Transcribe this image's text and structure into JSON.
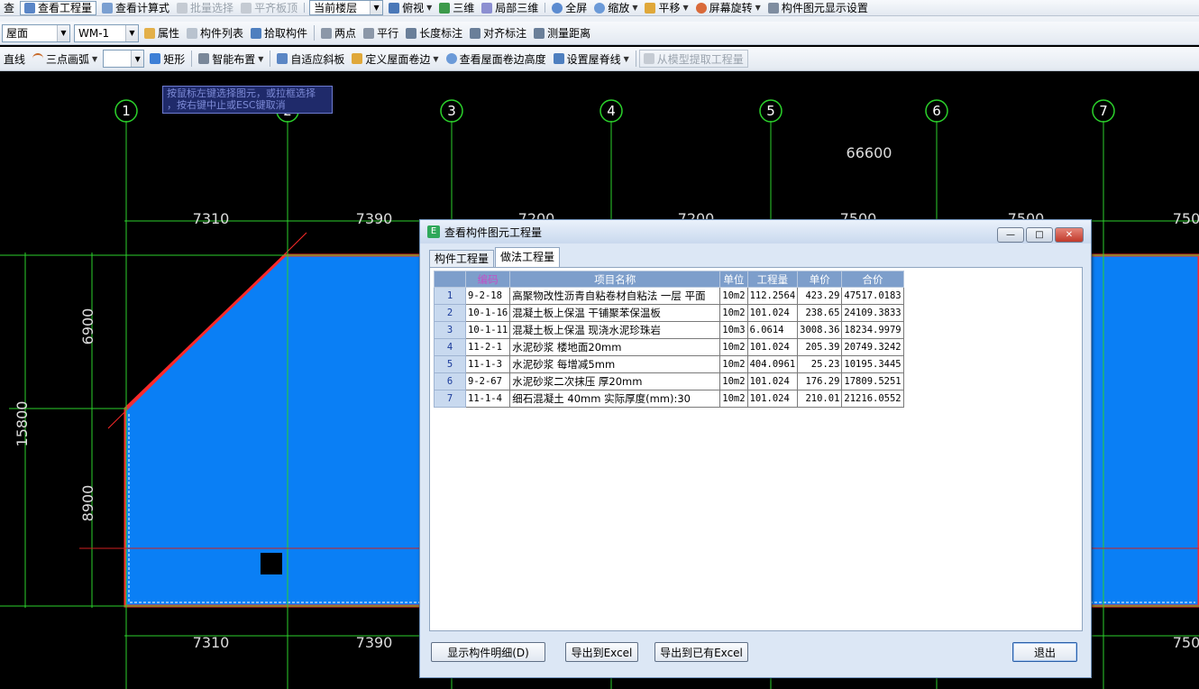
{
  "toolbar1": {
    "items": [
      {
        "label": "查",
        "state": "normal"
      },
      {
        "label": "查看工程量",
        "state": "active"
      },
      {
        "label": "查看计算式",
        "state": "normal"
      },
      {
        "label": "批量选择",
        "state": "disabled"
      },
      {
        "label": "平齐板顶",
        "state": "disabled"
      },
      {
        "label": "当前楼层",
        "state": "combo"
      },
      {
        "label": "俯视",
        "state": "normal"
      },
      {
        "label": "三维",
        "state": "normal"
      },
      {
        "label": "局部三维",
        "state": "normal"
      },
      {
        "label": "全屏",
        "state": "normal"
      },
      {
        "label": "缩放",
        "state": "normal"
      },
      {
        "label": "平移",
        "state": "normal"
      },
      {
        "label": "屏幕旋转",
        "state": "normal"
      },
      {
        "label": "构件图元显示设置",
        "state": "normal"
      }
    ]
  },
  "toolbar2": {
    "floor_combo": "屋面",
    "component_combo": "WM-1",
    "items": [
      "属性",
      "构件列表",
      "拾取构件",
      "两点",
      "平行",
      "长度标注",
      "对齐标注",
      "测量距离"
    ]
  },
  "toolbar3": {
    "line_label": "直线",
    "arc_combo": "三点画弧",
    "items": [
      "矩形",
      "智能布置",
      "自适应斜板",
      "定义屋面卷边",
      "查看屋面卷边高度",
      "设置屋脊线",
      "从模型提取工程量"
    ]
  },
  "canvas": {
    "tooltip_line1": "按鼠标左键选择图元，或拉框选择",
    "tooltip_line2": "，按右键中止或ESC键取消",
    "axis_labels": [
      "1",
      "2",
      "3",
      "4",
      "5",
      "6",
      "7"
    ],
    "total_dim": "66600",
    "top_dims": [
      "7310",
      "7390",
      "7200",
      "7200",
      "7500",
      "7500",
      "750"
    ],
    "bottom_dims": [
      "7310",
      "7390",
      "750"
    ],
    "left_total": "15800",
    "left_dims": [
      "6900",
      "8900"
    ]
  },
  "dialog": {
    "title": "查看构件图元工程量",
    "tabs": [
      "构件工程量",
      "做法工程量"
    ],
    "selected_tab": 1,
    "columns": [
      "编码",
      "项目名称",
      "单位",
      "工程量",
      "单价",
      "合价"
    ],
    "rows": [
      {
        "n": "1",
        "code": "9-2-18",
        "name": "高聚物改性沥青自粘卷材自粘法 一层 平面",
        "unit": "10m2",
        "qty": "112.2564",
        "price": "423.29",
        "total": "47517.0183"
      },
      {
        "n": "2",
        "code": "10-1-16",
        "name": "混凝土板上保温 干铺聚苯保温板",
        "unit": "10m2",
        "qty": "101.024",
        "price": "238.65",
        "total": "24109.3833"
      },
      {
        "n": "3",
        "code": "10-1-11",
        "name": "混凝土板上保温 现浇水泥珍珠岩",
        "unit": "10m3",
        "qty": "6.0614",
        "price": "3008.36",
        "total": "18234.9979"
      },
      {
        "n": "4",
        "code": "11-2-1",
        "name": "水泥砂浆 楼地面20mm",
        "unit": "10m2",
        "qty": "101.024",
        "price": "205.39",
        "total": "20749.3242"
      },
      {
        "n": "5",
        "code": "11-1-3",
        "name": "水泥砂浆 每增减5mm",
        "unit": "10m2",
        "qty": "404.0961",
        "price": "25.23",
        "total": "10195.3445"
      },
      {
        "n": "6",
        "code": "9-2-67",
        "name": "水泥砂浆二次抹压 厚20mm",
        "unit": "10m2",
        "qty": "101.024",
        "price": "176.29",
        "total": "17809.5251"
      },
      {
        "n": "7",
        "code": "11-1-4",
        "name": "细石混凝土 40mm 实际厚度(mm):30",
        "unit": "10m2",
        "qty": "101.024",
        "price": "210.01",
        "total": "21216.0552"
      }
    ],
    "buttons": {
      "show_detail": "显示构件明细(D)",
      "export_excel": "导出到Excel",
      "export_existing": "导出到已有Excel",
      "exit": "退出"
    }
  },
  "colors": {
    "canvas_bg": "#000000",
    "slab_fill": "#0a7ff5",
    "grid_line": "#2bd12b",
    "boundary": "#ff2020",
    "header_bg": "#7d9ecb"
  }
}
